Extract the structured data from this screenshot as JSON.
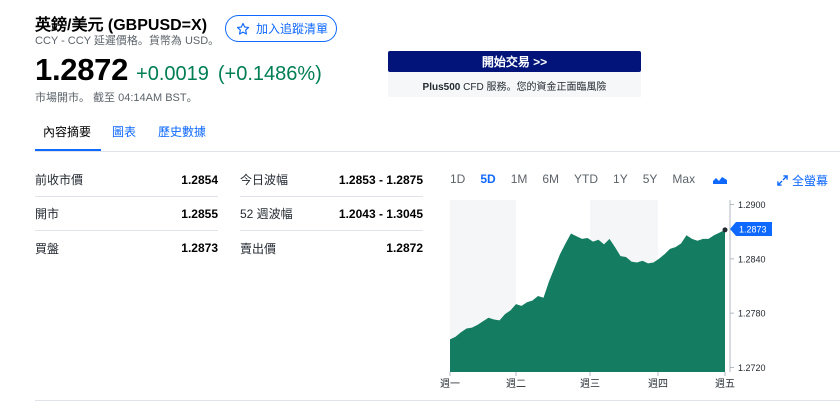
{
  "header": {
    "title": "英鎊/美元 (GBPUSD=X)",
    "subtitle": "CCY - CCY 延遲價格。貨幣為 USD。",
    "watchlist_label": "加入追蹤清單"
  },
  "quote": {
    "price": "1.2872",
    "change": "+0.0019",
    "change_pct": "(+0.1486%)",
    "status": "市場開市。 截至 04:14AM BST。",
    "color_up": "#007e53"
  },
  "trade": {
    "button_label": "開始交易 >>",
    "brand": "Plus500",
    "note": " CFD 服務。您的資金正面臨風險"
  },
  "tabs": [
    {
      "label": "內容摘要",
      "active": true
    },
    {
      "label": "圖表",
      "active": false
    },
    {
      "label": "歷史數據",
      "active": false
    }
  ],
  "stats_left": [
    {
      "label": "前收市價",
      "value": "1.2854"
    },
    {
      "label": "開市",
      "value": "1.2855"
    },
    {
      "label": "買盤",
      "value": "1.2873"
    }
  ],
  "stats_right": [
    {
      "label": "今日波幅",
      "value": "1.2853 - 1.2875"
    },
    {
      "label": "52 週波幅",
      "value": "1.2043 - 1.3045"
    },
    {
      "label": "賣出價",
      "value": "1.2872"
    }
  ],
  "ranges": [
    "1D",
    "5D",
    "1M",
    "6M",
    "YTD",
    "1Y",
    "5Y",
    "Max"
  ],
  "active_range": "5D",
  "chart_type_icon": "area-chart-icon",
  "fullscreen_label": "全螢幕",
  "chart_data": {
    "type": "area",
    "x": [
      "週一",
      "週二",
      "週三",
      "週四",
      "週五"
    ],
    "y_ticks": [
      "1.2900",
      "1.2840",
      "1.2780",
      "1.2720"
    ],
    "ylim": [
      1.2715,
      1.2905
    ],
    "current_price_label": "1.2873",
    "fill_color": "#137c61",
    "marker_color": "#0f69ff",
    "series": [
      {
        "values": [
          1.2751,
          1.2754,
          1.2759,
          1.2763,
          1.2764,
          1.2767,
          1.2771,
          1.2775,
          1.2773,
          1.2772,
          1.2779,
          1.2783,
          1.279,
          1.2788,
          1.2792,
          1.2794,
          1.2799,
          1.2797,
          1.2815,
          1.283,
          1.2845,
          1.2857,
          1.2868,
          1.2865,
          1.2862,
          1.2863,
          1.2859,
          1.2861,
          1.2856,
          1.2862,
          1.2853,
          1.2843,
          1.2842,
          1.2837,
          1.2836,
          1.2838,
          1.2835,
          1.2836,
          1.284,
          1.2845,
          1.2851,
          1.2853,
          1.2857,
          1.2866,
          1.2862,
          1.286,
          1.2862,
          1.2862,
          1.2866,
          1.2869,
          1.2872
        ]
      }
    ]
  }
}
